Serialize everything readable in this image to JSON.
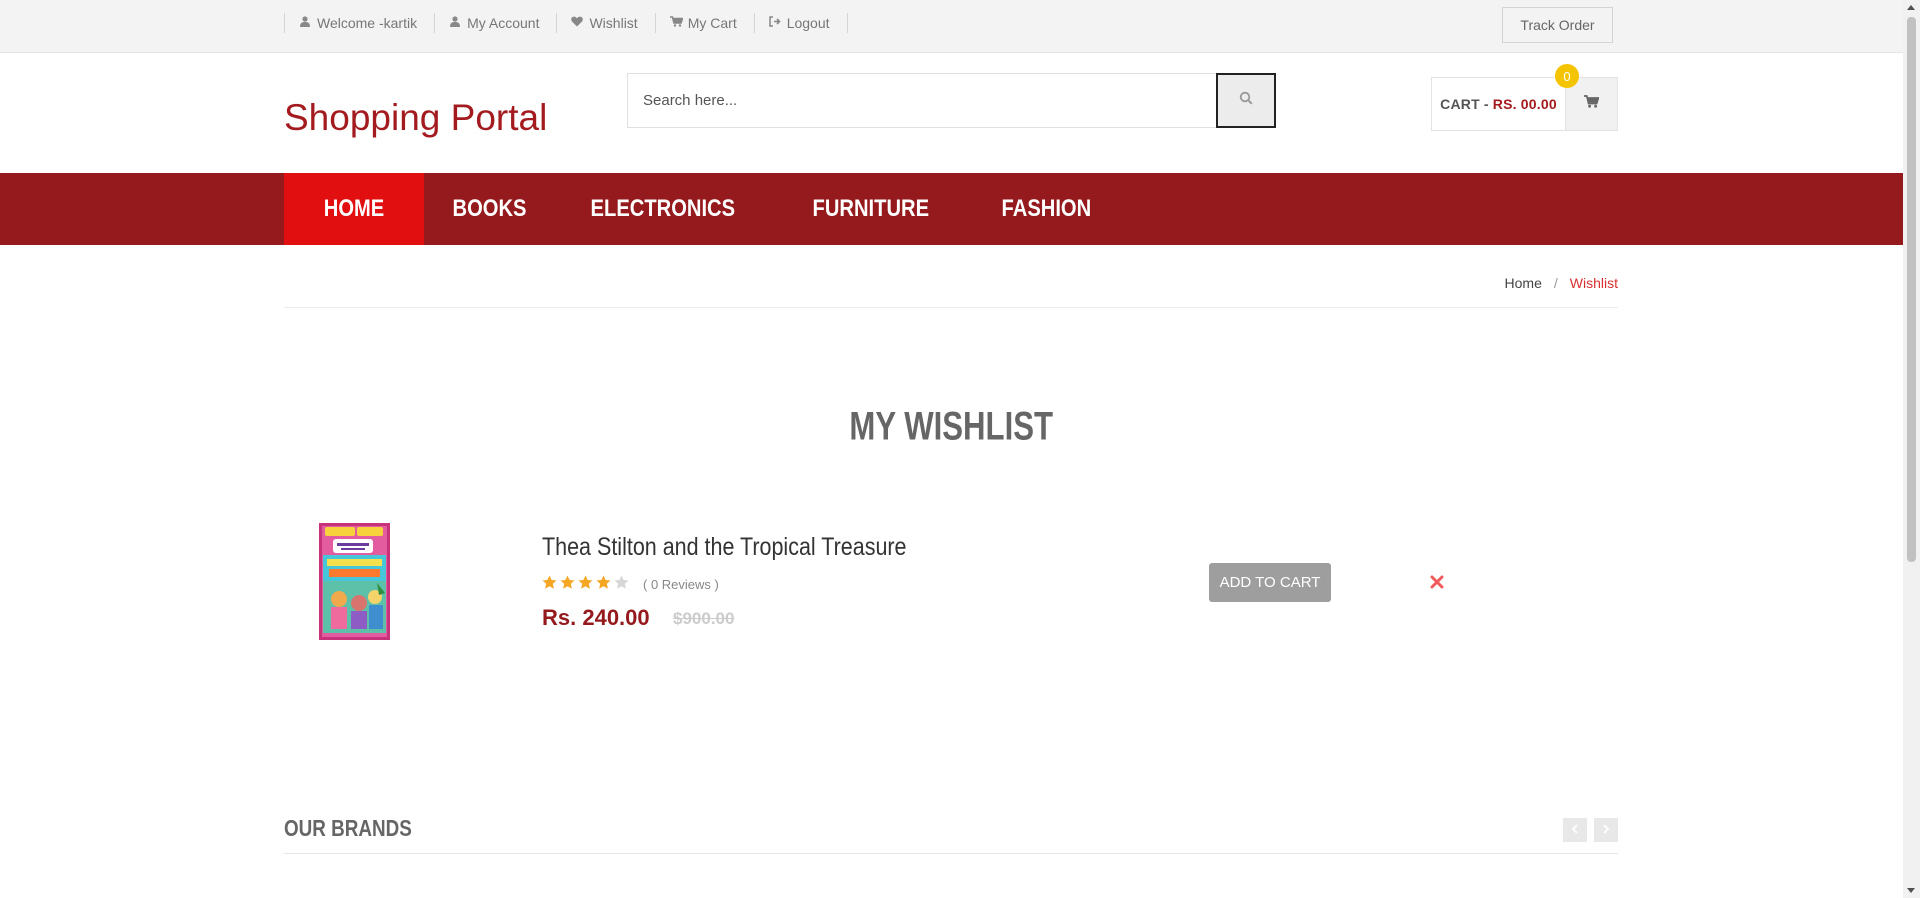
{
  "topbar": {
    "links": [
      {
        "icon": "user-icon",
        "label": "Welcome -kartik"
      },
      {
        "icon": "user-icon",
        "label": "My Account"
      },
      {
        "icon": "heart-icon",
        "label": "Wishlist"
      },
      {
        "icon": "shopping-cart-icon",
        "label": "My Cart"
      },
      {
        "icon": "sign-out-icon",
        "label": "Logout"
      }
    ],
    "track_order": "Track Order"
  },
  "header": {
    "logo": "Shopping Portal",
    "search_placeholder": "Search here...",
    "cart_label": "CART -",
    "cart_amount": "RS. 00.00",
    "cart_count": "0"
  },
  "nav": {
    "items": [
      "HOME",
      "BOOKS",
      "ELECTRONICS",
      "FURNITURE",
      "FASHION"
    ],
    "active": "HOME"
  },
  "breadcrumb": {
    "home": "Home",
    "separator": "/",
    "current": "Wishlist"
  },
  "wishlist": {
    "title": "MY WISHLIST",
    "items": [
      {
        "name": "Thea Stilton and the Tropical Treasure",
        "rating": 4,
        "rating_max": 5,
        "reviews": "( 0 Reviews )",
        "price": "Rs. 240.00",
        "old_price": "$900.00",
        "add_to_cart": "ADD TO CART"
      }
    ]
  },
  "brands": {
    "title": "OUR BRANDS"
  },
  "colors": {
    "brand": "#951a1d",
    "nav_active": "#e10f0f",
    "badge": "#f5c400",
    "star": "#f5a623"
  }
}
